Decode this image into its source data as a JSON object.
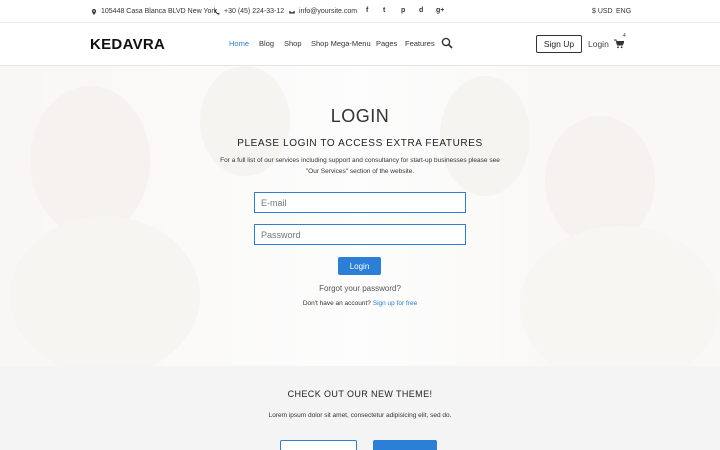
{
  "topbar": {
    "address": "105448 Casa Blanca BLVD New York",
    "phone": "+30 (45) 224-33-12",
    "email": "info@yoursite.com",
    "social_icons": [
      "facebook-icon",
      "twitter-icon",
      "pinterest-icon",
      "dribbble-icon",
      "google-plus-icon"
    ],
    "social_glyphs": [
      "f",
      "t",
      "p",
      "d",
      "g+"
    ],
    "currency": "$ USD",
    "language": "ENG"
  },
  "header": {
    "logo": "KEDAVRA",
    "nav": [
      "Home",
      "Blog",
      "Shop",
      "Shop Mega-Menu",
      "Pages",
      "Features"
    ],
    "active_nav": "Home",
    "signup_label": "Sign Up",
    "login_label": "Login",
    "cart_count": "4"
  },
  "login": {
    "title": "LOGIN",
    "subtitle": "PLEASE LOGIN TO ACCESS EXTRA FEATURES",
    "description": "For a full list of our services including support and consultancy for start-up businesses please see \"Our Services\" section of the website.",
    "email_placeholder": "E-mail",
    "password_placeholder": "Password",
    "button_label": "Login",
    "forgot_label": "Forgot your password?",
    "no_account_text": "Don't have an account?",
    "signup_link": "Sign up for free"
  },
  "promo": {
    "title": "CHECK OUT OUR NEW THEME!",
    "text": "Lorem ipsum dolor sit amet, consectetur adipisicing elit, sed do."
  },
  "colors": {
    "accent": "#2b7fd6",
    "text": "#333333",
    "promo_bg": "#f4f4f4"
  }
}
